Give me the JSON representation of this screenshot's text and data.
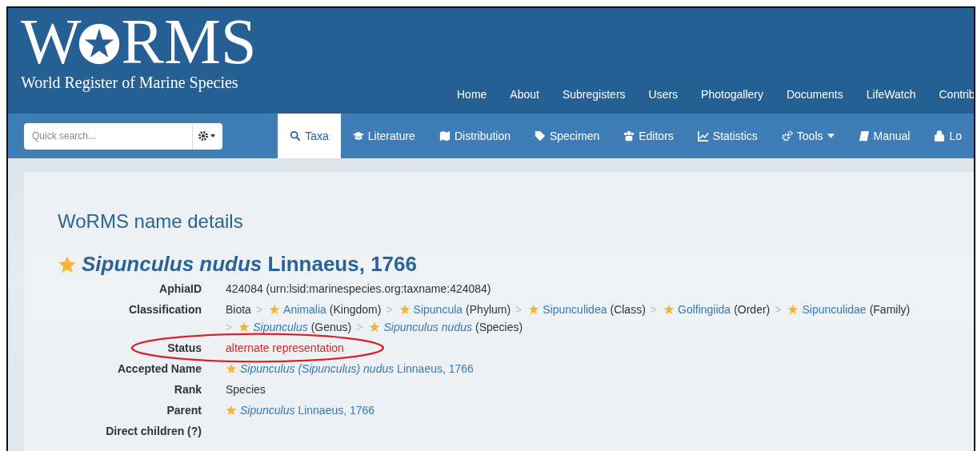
{
  "logo": {
    "letters_before": "W",
    "letters_after": "RMS",
    "subtitle": "World Register of Marine Species"
  },
  "top_nav": [
    "Home",
    "About",
    "Subregisters",
    "Users",
    "Photogallery",
    "Documents",
    "LifeWatch",
    "Contrib"
  ],
  "search": {
    "placeholder": "Quick search..."
  },
  "tabs": [
    {
      "label": "Taxa",
      "selected": true,
      "dropdown": false
    },
    {
      "label": "Literature",
      "selected": false,
      "dropdown": false
    },
    {
      "label": "Distribution",
      "selected": false,
      "dropdown": false
    },
    {
      "label": "Specimen",
      "selected": false,
      "dropdown": false
    },
    {
      "label": "Editors",
      "selected": false,
      "dropdown": false
    },
    {
      "label": "Statistics",
      "selected": false,
      "dropdown": false
    },
    {
      "label": "Tools",
      "selected": false,
      "dropdown": true
    },
    {
      "label": "Manual",
      "selected": false,
      "dropdown": false
    },
    {
      "label": "Lo",
      "selected": false,
      "dropdown": false
    }
  ],
  "page_title": "WoRMS name details",
  "taxon_heading": {
    "text": "*Sipunculus nudus* Linnaeus, 1766",
    "starred": true
  },
  "details": [
    {
      "label": "AphiaID",
      "kind": "text",
      "value": "424084  (urn:lsid:marinespecies.org:taxname:424084)"
    },
    {
      "label": "Classification",
      "kind": "classification",
      "separator": ">",
      "items": [
        {
          "name": "Biota",
          "starred": false,
          "link": false
        },
        {
          "name": "Animalia",
          "rank": "(Kingdom)",
          "starred": true,
          "link": true
        },
        {
          "name": "Sipuncula",
          "rank": "(Phylum)",
          "starred": true,
          "link": true
        },
        {
          "name": "Sipunculidea",
          "rank": "(Class)",
          "starred": true,
          "link": true
        },
        {
          "name": "Golfingiida",
          "rank": "(Order)",
          "starred": true,
          "link": true
        },
        {
          "name": "Sipunculidae",
          "rank": "(Family)",
          "starred": true,
          "link": true
        },
        {
          "name": "*Sipunculus*",
          "rank": "(Genus)",
          "starred": true,
          "link": true
        },
        {
          "name": "*Sipunculus nudus*",
          "rank": "(Species)",
          "starred": true,
          "link": true
        }
      ]
    },
    {
      "label": "Status",
      "kind": "status",
      "value": "alternate representation",
      "highlighted": true
    },
    {
      "label": "Accepted Name",
      "kind": "taxon",
      "value": "*Sipunculus (Sipunculus) nudus* Linnaeus, 1766"
    },
    {
      "label": "Rank",
      "kind": "text",
      "value": "Species"
    },
    {
      "label": "Parent",
      "kind": "taxon",
      "value": "*Sipunculus* Linnaeus, 1766"
    },
    {
      "label": "Direct children (?)",
      "kind": "text"
    }
  ]
}
